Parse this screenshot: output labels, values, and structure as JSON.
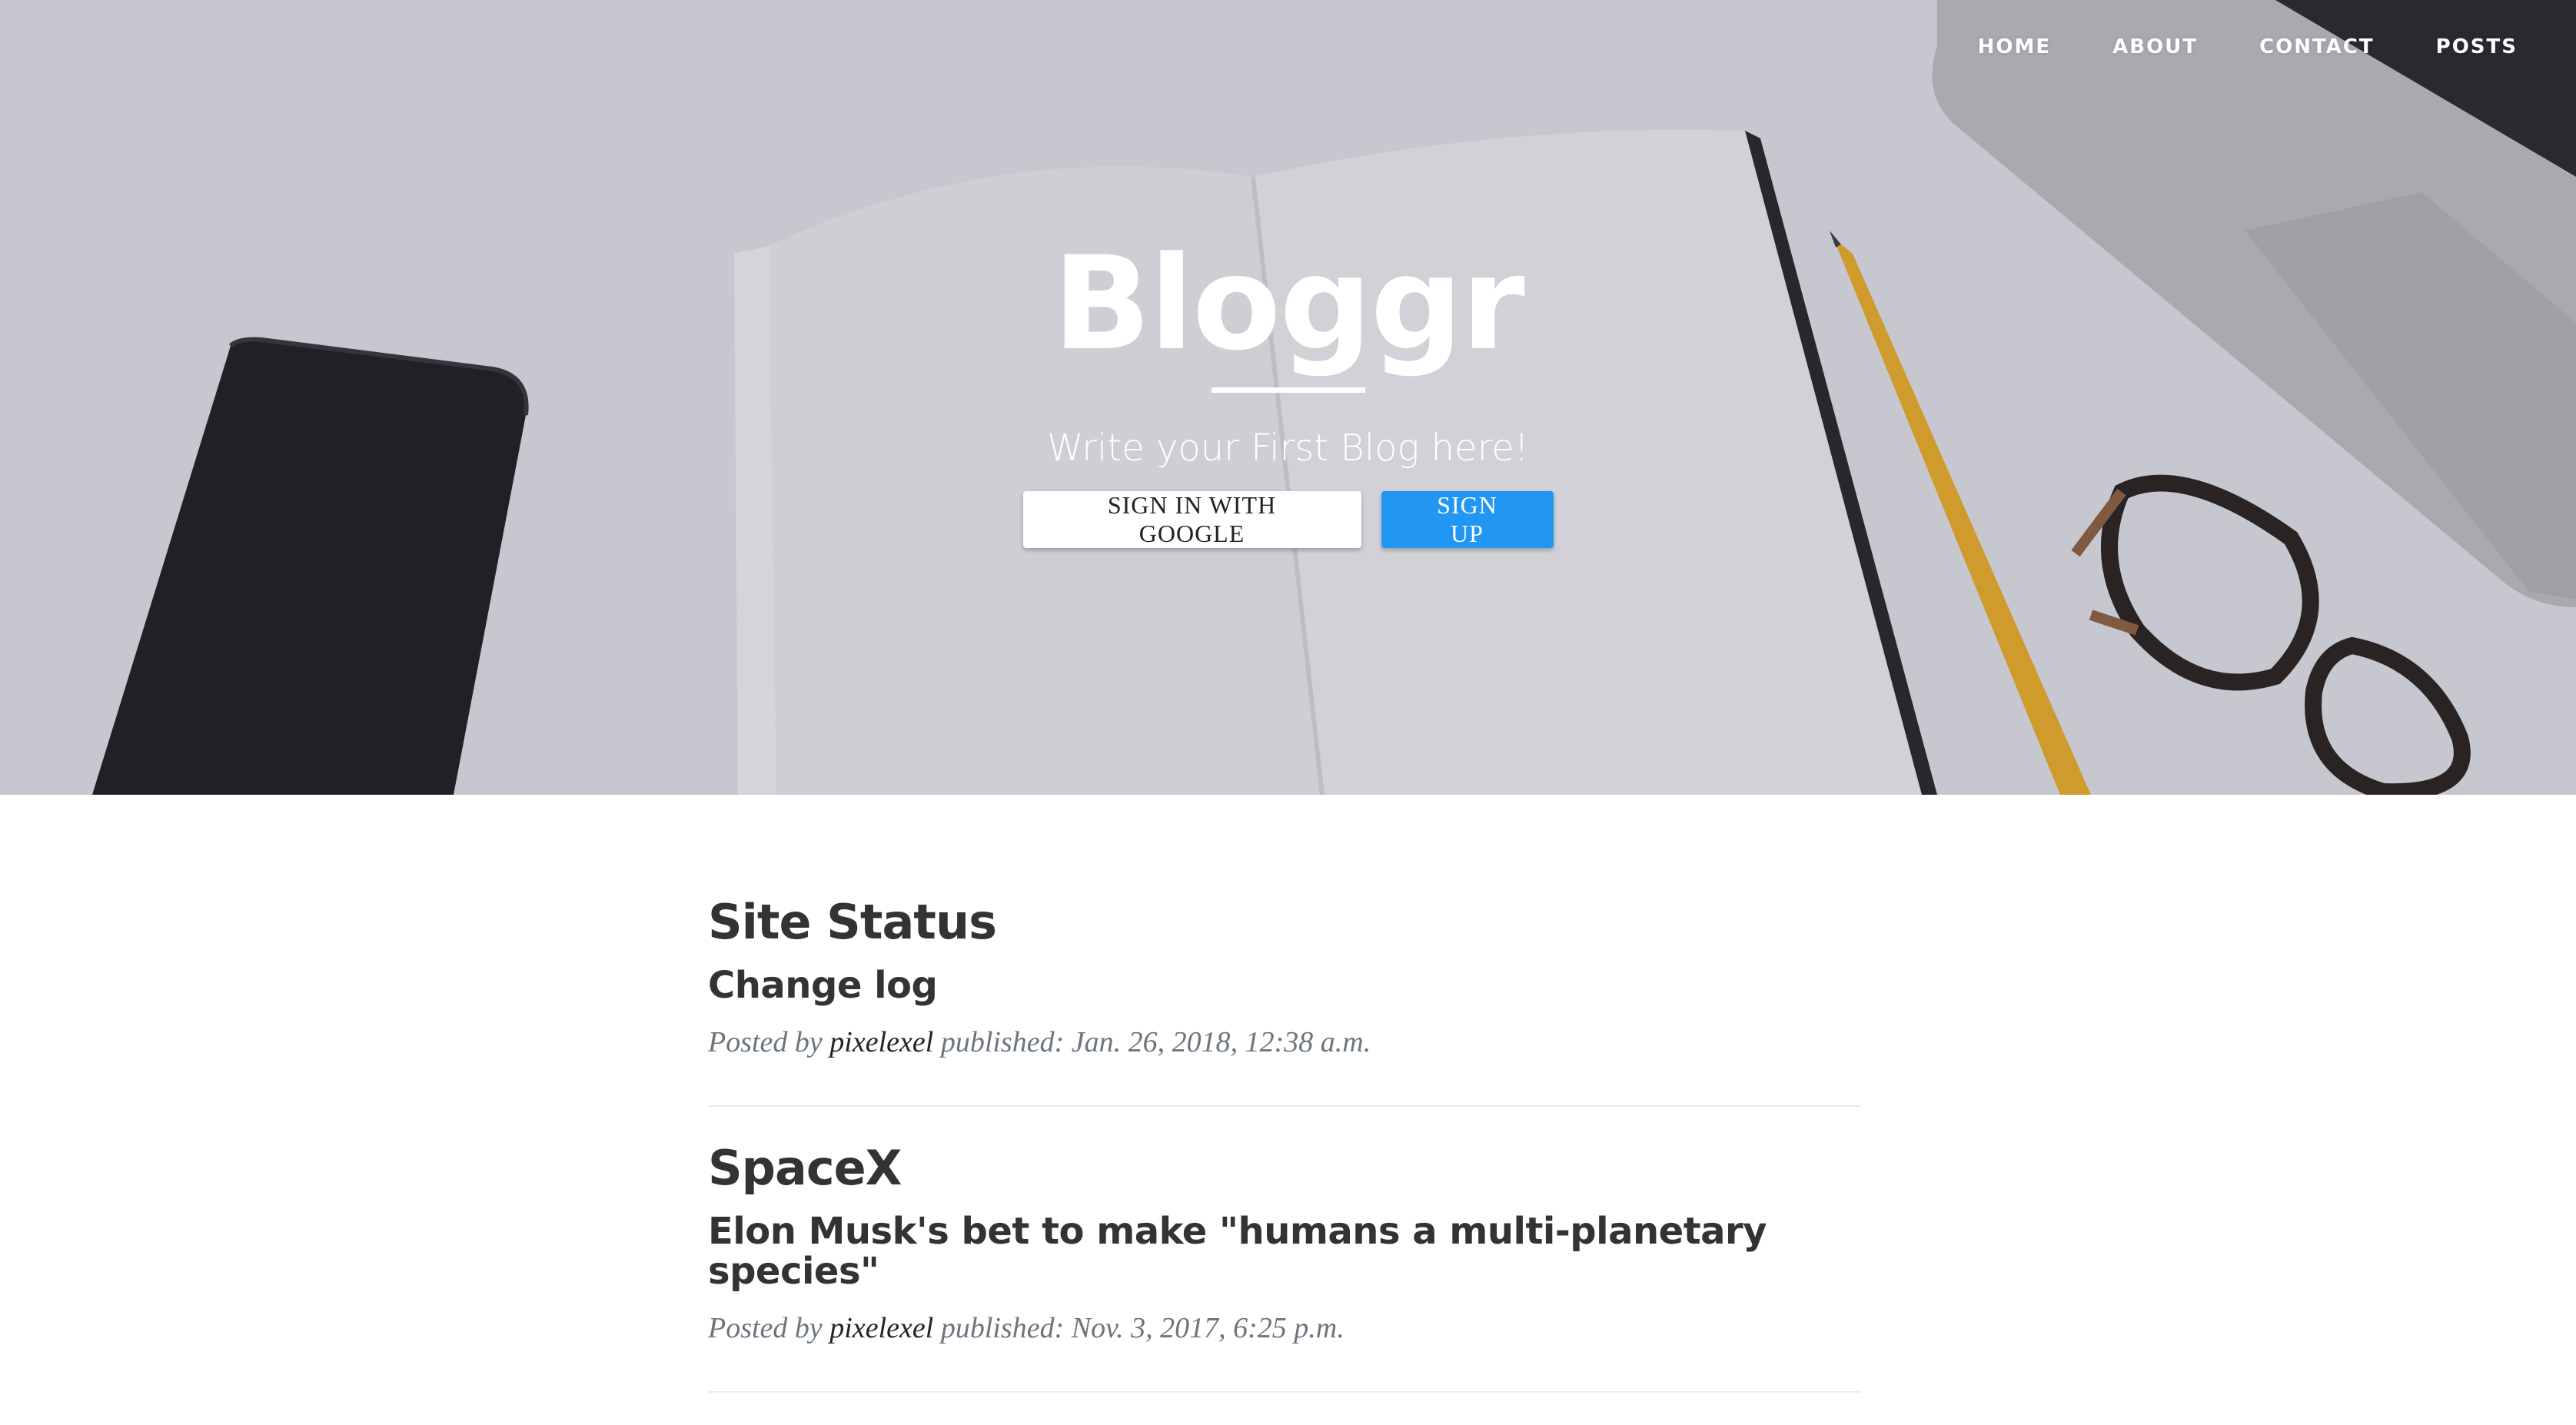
{
  "nav": {
    "items": [
      "Home",
      "About",
      "Contact",
      "Posts"
    ]
  },
  "hero": {
    "title": "Bloggr",
    "subtitle": "Write your First Blog here!",
    "google_button": "SIGN IN WITH GOOGLE",
    "signup_button": "SIGN UP"
  },
  "posts": [
    {
      "title": "Site Status",
      "subtitle": "Change log",
      "meta_prefix": "Posted by",
      "author": "pixelexel",
      "meta_suffix": "published: Jan. 26, 2018, 12:38 a.m."
    },
    {
      "title": "SpaceX",
      "subtitle": "Elon Musk's bet to make \"humans a multi-planetary species\"",
      "meta_prefix": "Posted by",
      "author": "pixelexel",
      "meta_suffix": "published: Nov. 3, 2017, 6:25 p.m."
    }
  ],
  "colors": {
    "signup_blue": "#2196f3",
    "heading_dark": "#333333",
    "meta_gray": "#6c757d"
  }
}
